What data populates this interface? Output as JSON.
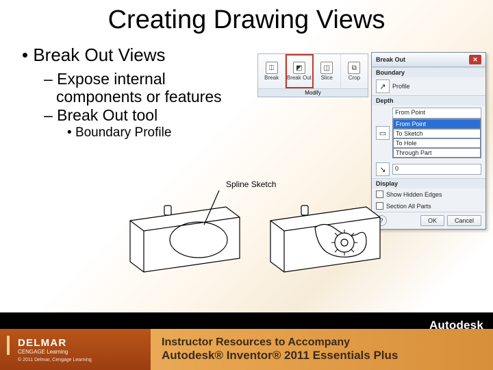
{
  "title": "Creating Drawing Views",
  "bullets": {
    "l1": "Break Out Views",
    "l2a": "– Expose internal",
    "l2a_cont": "components or features",
    "l2b": "– Break Out tool",
    "l3": "Boundary Profile"
  },
  "ribbon": {
    "items": [
      {
        "label": "Break",
        "icon": "⎅"
      },
      {
        "label": "Break Out",
        "icon": "◩"
      },
      {
        "label": "Slice",
        "icon": "◫"
      },
      {
        "label": "Crop",
        "icon": "⧉"
      }
    ],
    "panel": "Modify"
  },
  "dialog": {
    "title": "Break Out",
    "close": "✕",
    "sections": {
      "boundary": {
        "header": "Boundary",
        "icon": "↗",
        "value": "Profile"
      },
      "depth": {
        "header": "Depth",
        "icon": "▭",
        "selected": "From Point",
        "options": [
          "From Point",
          "To Sketch",
          "To Hole",
          "Through Part"
        ],
        "value": "0"
      },
      "display": {
        "header": "Display",
        "chk1": "Show Hidden Edges",
        "chk2": "Section All Parts"
      }
    },
    "buttons": {
      "q": "?",
      "ok": "OK",
      "cancel": "Cancel"
    }
  },
  "diagram": {
    "label": "Spline Sketch"
  },
  "blackbar": {
    "brand": "Autodesk"
  },
  "footer": {
    "delmar": {
      "name": "DELMAR",
      "sub": "CENGAGE Learning",
      "copy": "© 2011 Delmar, Cengage Learning"
    },
    "line1": "Instructor Resources to Accompany",
    "line2": "Autodesk® Inventor® 2011 Essentials Plus"
  }
}
